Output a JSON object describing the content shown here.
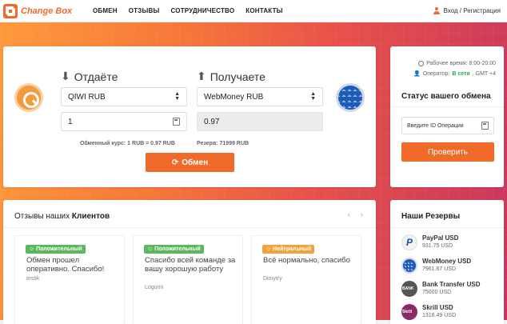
{
  "header": {
    "logo_text": "Change Box",
    "nav": [
      "ОБМЕН",
      "ОТЗЫВЫ",
      "СОТРУДНИЧЕСТВО",
      "КОНТАКТЫ"
    ],
    "login": "Вход / Регистрация"
  },
  "colors": {
    "accent": "#f06a2a",
    "online": "#2aa64b",
    "positive": "#5cb85c",
    "neutral": "#f0a33a"
  },
  "exchange": {
    "give_title": "Отдаёте",
    "get_title": "Получаете",
    "give_currency": "QIWI RUB",
    "get_currency": "WebMoney RUB",
    "give_amount": "1",
    "get_amount": "0.97",
    "rate": "Обменный курс: 1 RUB = 0.97 RUB",
    "reserve": "Резерв: 71999 RUB",
    "button": "Обмен",
    "give_icon": "qiwi-icon",
    "get_icon": "webmoney-icon"
  },
  "status": {
    "work_time": "Рабочее время: 8:00-20:00",
    "operator_label": "Оператор:",
    "operator_status": "В сети",
    "timezone": ", GMT +4",
    "title": "Статус вашего обмена",
    "input_placeholder": "Введите ID Операции",
    "button": "Проверить"
  },
  "reviews": {
    "title_prefix": "Отзывы наших",
    "title_bold": "Клиентов",
    "items": [
      {
        "badge": "Положительный",
        "text": "Обмен прошел оперативно. Спасибо!",
        "author": "testik"
      },
      {
        "badge": "Положительный",
        "text": "Спасибо всей команде за вашу хорошую работу",
        "author": "Logurin"
      },
      {
        "badge": "Нейтральный",
        "text": "Всё нормально, спасибо",
        "author": "Dimytry"
      }
    ]
  },
  "reserves": {
    "title": "Наши Резервы",
    "items": [
      {
        "name": "PayPal USD",
        "value": "931.75 USD"
      },
      {
        "name": "WebMoney USD",
        "value": "7961.67 USD"
      },
      {
        "name": "Bank Transfer USD",
        "value": "75000 USD"
      },
      {
        "name": "Skrill USD",
        "value": "1316.49 USD"
      }
    ]
  }
}
